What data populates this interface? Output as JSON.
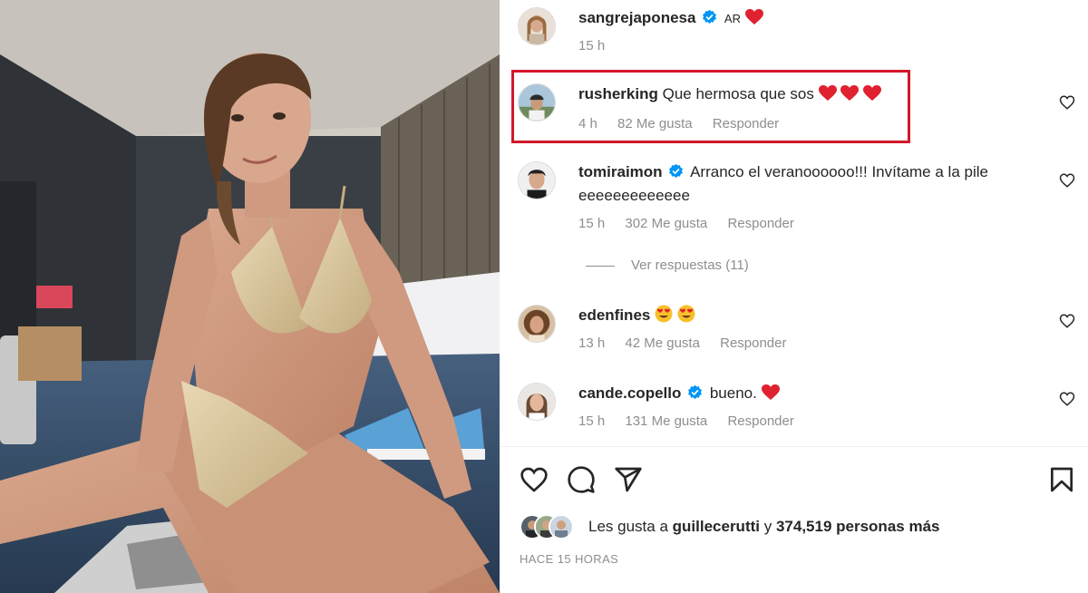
{
  "photo": {
    "alt_icon": "photo-of-woman-on-hotel-floor"
  },
  "caption": {
    "username": "sangrejaponesa",
    "verified": true,
    "text": "AR",
    "time": "15 h"
  },
  "comments": [
    {
      "username": "rusherking",
      "verified": false,
      "text": "Que hermosa que sos",
      "emoji": [
        "red-heart",
        "red-heart",
        "red-heart"
      ],
      "time": "4 h",
      "likes": "82 Me gusta",
      "reply": "Responder",
      "highlighted": true
    },
    {
      "username": "tomiraimon",
      "verified": true,
      "text": "Arranco el veranoooooo!!! Invítame a la pile",
      "text_line2": "eeeeeeeeeeeee",
      "time": "15 h",
      "likes": "302 Me gusta",
      "reply": "Responder"
    },
    {
      "username": "edenfines",
      "verified": false,
      "text": "",
      "emoji": [
        "heart-eyes",
        "heart-eyes"
      ],
      "time": "13 h",
      "likes": "42 Me gusta",
      "reply": "Responder"
    },
    {
      "username": "cande.copello",
      "verified": true,
      "text": "bueno.",
      "emoji": [
        "red-heart"
      ],
      "time": "15 h",
      "likes": "131 Me gusta",
      "reply": "Responder"
    }
  ],
  "view_replies": "Ver respuestas (11)",
  "likes_summary": {
    "prefix": "Les gusta a",
    "user": "guillecerutti",
    "connector": "y",
    "count": "374,519 personas más"
  },
  "post_time": "HACE 15 HORAS",
  "colors": {
    "highlight_border": "#d3172a",
    "verified": "#0095f6",
    "heart": "#e0212f",
    "muted_text": "#8e8e8e"
  }
}
